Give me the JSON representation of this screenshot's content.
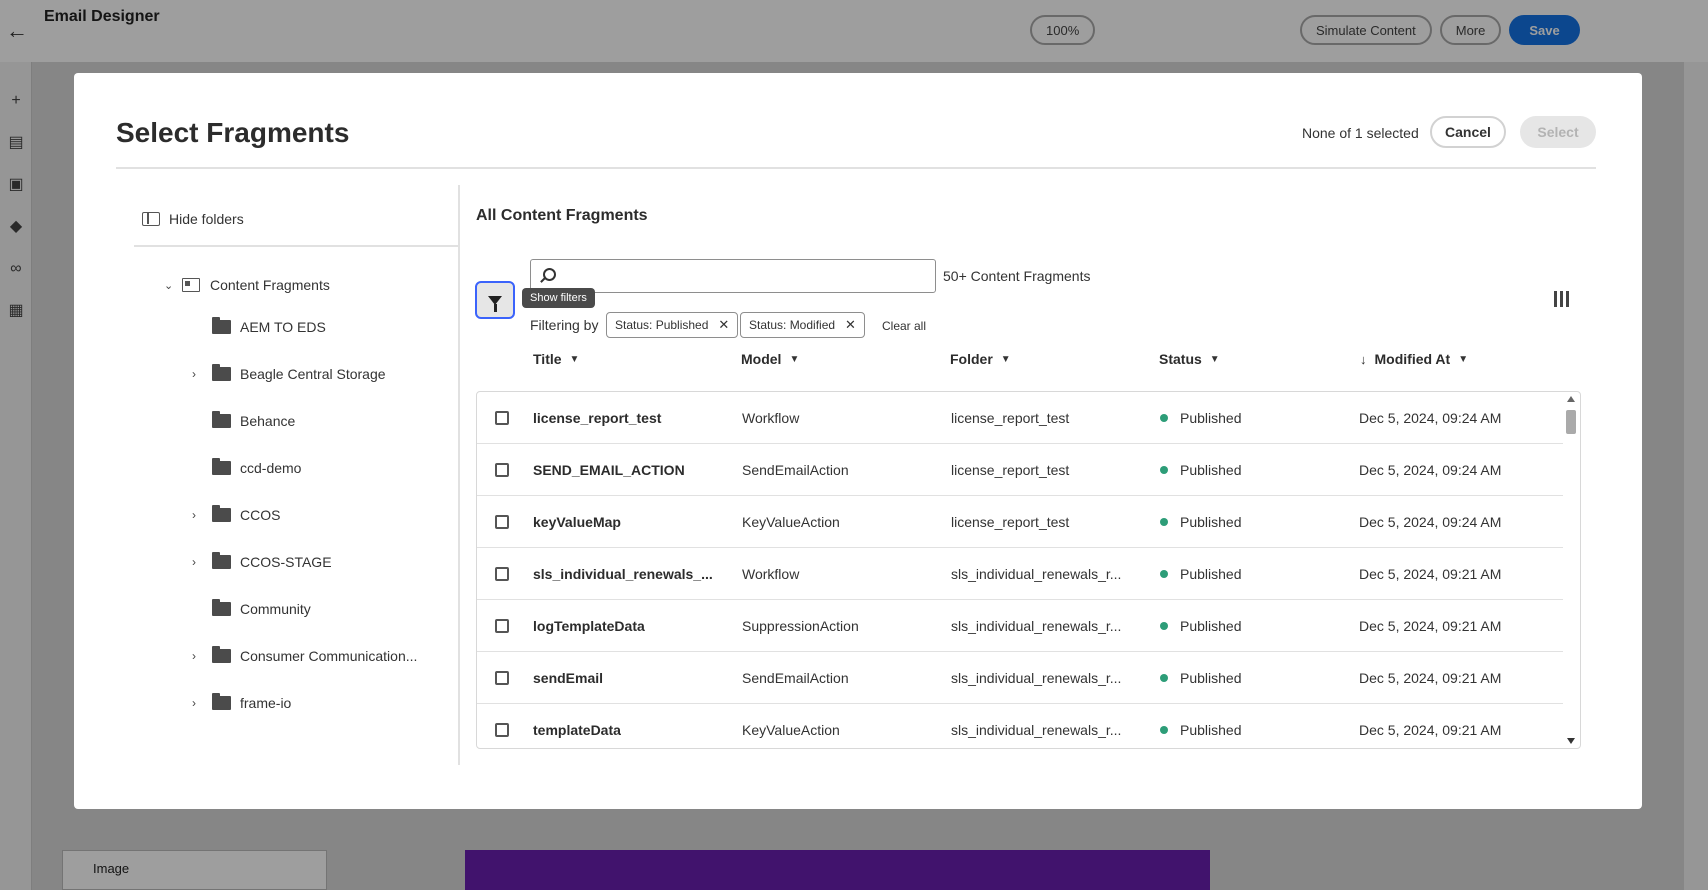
{
  "app": {
    "title": "Email Designer",
    "zoom": "100%",
    "simulate": "Simulate Content",
    "more": "More",
    "save": "Save",
    "bottom_panel_label": "Image"
  },
  "modal": {
    "title": "Select Fragments",
    "selection_status": "None of 1 selected",
    "cancel_label": "Cancel",
    "select_label": "Select"
  },
  "folders": {
    "hide_label": "Hide folders",
    "root_label": "Content Fragments",
    "items": [
      {
        "label": "AEM TO EDS",
        "expandable": false
      },
      {
        "label": "Beagle Central Storage",
        "expandable": true
      },
      {
        "label": "Behance",
        "expandable": false
      },
      {
        "label": "ccd-demo",
        "expandable": false
      },
      {
        "label": "CCOS",
        "expandable": true
      },
      {
        "label": "CCOS-STAGE",
        "expandable": true
      },
      {
        "label": "Community",
        "expandable": false
      },
      {
        "label": "Consumer Communication...",
        "expandable": true
      },
      {
        "label": "frame-io",
        "expandable": true
      }
    ]
  },
  "content": {
    "title": "All Content Fragments",
    "search_placeholder": "",
    "count_label": "50+ Content Fragments",
    "filter_tooltip": "Show filters",
    "filtering_by_label": "Filtering by",
    "filter_tags": [
      "Status: Published",
      "Status: Modified"
    ],
    "clear_all_label": "Clear all"
  },
  "table": {
    "columns": [
      "Title",
      "Model",
      "Folder",
      "Status",
      "Modified At"
    ],
    "sort_column": "Modified At",
    "rows": [
      {
        "title": "license_report_test",
        "model": "Workflow",
        "folder": "license_report_test",
        "status": "Published",
        "modified": "Dec 5, 2024, 09:24 AM"
      },
      {
        "title": "SEND_EMAIL_ACTION",
        "model": "SendEmailAction",
        "folder": "license_report_test",
        "status": "Published",
        "modified": "Dec 5, 2024, 09:24 AM"
      },
      {
        "title": "keyValueMap",
        "model": "KeyValueAction",
        "folder": "license_report_test",
        "status": "Published",
        "modified": "Dec 5, 2024, 09:24 AM"
      },
      {
        "title": "sls_individual_renewals_...",
        "model": "Workflow",
        "folder": "sls_individual_renewals_r...",
        "status": "Published",
        "modified": "Dec 5, 2024, 09:21 AM"
      },
      {
        "title": "logTemplateData",
        "model": "SuppressionAction",
        "folder": "sls_individual_renewals_r...",
        "status": "Published",
        "modified": "Dec 5, 2024, 09:21 AM"
      },
      {
        "title": "sendEmail",
        "model": "SendEmailAction",
        "folder": "sls_individual_renewals_r...",
        "status": "Published",
        "modified": "Dec 5, 2024, 09:21 AM"
      },
      {
        "title": "templateData",
        "model": "KeyValueAction",
        "folder": "sls_individual_renewals_r...",
        "status": "Published",
        "modified": "Dec 5, 2024, 09:21 AM"
      }
    ]
  },
  "colors": {
    "accent": "#3b63fb",
    "published": "#2d9d78",
    "save_button": "#1473e6"
  }
}
